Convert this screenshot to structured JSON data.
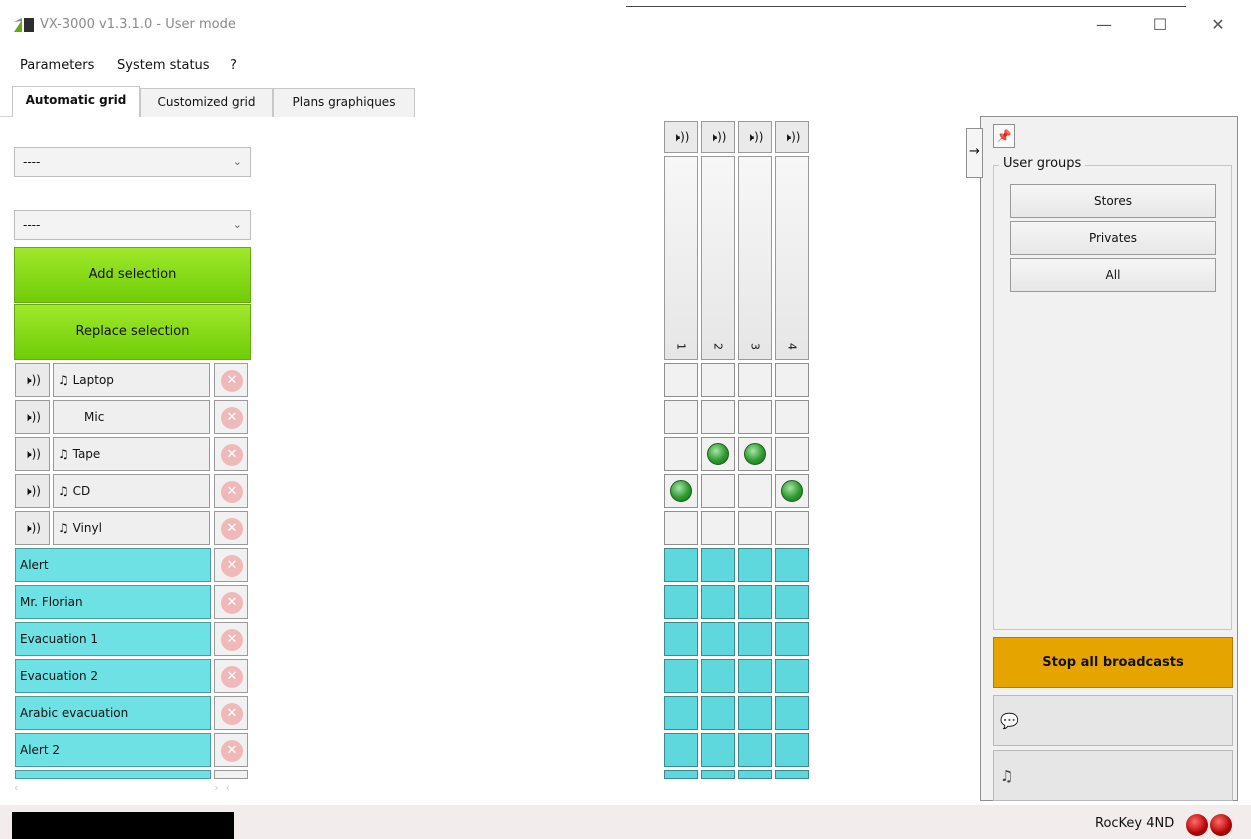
{
  "window": {
    "title": "VX-3000 v1.3.1.0 - User mode"
  },
  "menu": {
    "items": [
      "Parameters",
      "System status",
      "?"
    ]
  },
  "tabs": [
    "Automatic grid",
    "Customized grid",
    "Plans graphiques"
  ],
  "dropdowns": {
    "first": "----",
    "second": "----"
  },
  "buttons": {
    "add_selection": "Add selection",
    "replace_selection": "Replace selection"
  },
  "icons": {
    "speaker": "🕨))",
    "music": "♫",
    "delete": "✕",
    "pin": "📌",
    "arrow": "→",
    "chat": "💬"
  },
  "sources": [
    {
      "name": "Laptop",
      "music": true
    },
    {
      "name": "Mic",
      "music": false
    },
    {
      "name": "Tape",
      "music": true
    },
    {
      "name": "CD",
      "music": true
    },
    {
      "name": "Vinyl",
      "music": true
    }
  ],
  "messages": [
    "Alert",
    "Mr. Florian",
    "Evacuation 1",
    "Evacuation 2",
    "Arabic evacuation",
    "Alert 2"
  ],
  "zones": [
    "1",
    "2",
    "3",
    "4"
  ],
  "grid_active": {
    "Laptop": [
      false,
      false,
      false,
      false
    ],
    "Mic": [
      false,
      false,
      false,
      false
    ],
    "Tape": [
      false,
      true,
      true,
      false
    ],
    "CD": [
      true,
      false,
      false,
      true
    ],
    "Vinyl": [
      false,
      false,
      false,
      false
    ]
  },
  "right_panel": {
    "groups_title": "User groups",
    "groups": [
      "Stores",
      "Privates",
      "All"
    ],
    "stop_label": "Stop all broadcasts"
  },
  "status": {
    "rockey_label": "RocKey 4ND"
  },
  "colors": {
    "green": "#8ee01a",
    "cyan": "#6ee1e4",
    "orange": "#e6a400",
    "led_red": "#b40000",
    "active_dot": "#2e9a2e"
  }
}
